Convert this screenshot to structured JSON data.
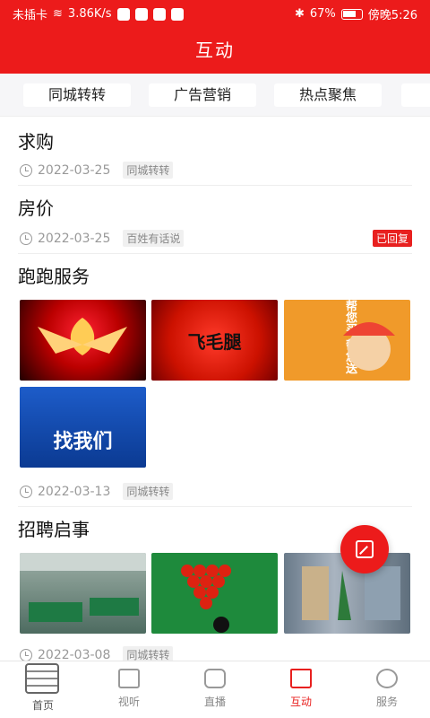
{
  "status_bar": {
    "carrier": "未插卡",
    "speed": "3.86K/s",
    "battery": "67%",
    "time": "傍晚5:26"
  },
  "header": {
    "title": "互动"
  },
  "tabs": [
    {
      "label": "同城转转"
    },
    {
      "label": "广告营销"
    },
    {
      "label": "热点聚焦"
    }
  ],
  "posts": [
    {
      "title": "求购",
      "date": "2022-03-25",
      "tag": "同城转转"
    },
    {
      "title": "房价",
      "date": "2022-03-25",
      "tag": "百姓有话说",
      "badge": "已回复"
    },
    {
      "title": "跑跑服务",
      "date": "2022-03-13",
      "tag": "同城转转",
      "images": [
        {
          "name": "flame-logo-image",
          "text": ""
        },
        {
          "name": "fei-mao-tui-image",
          "text": "飞毛腿"
        },
        {
          "name": "uu-errand-image",
          "text": "帮您买 帮您送"
        },
        {
          "name": "paotui-service-image",
          "text": "找我们"
        }
      ]
    },
    {
      "title": "招聘启事",
      "date": "2022-03-08",
      "tag": "同城转转",
      "images": [
        {
          "name": "billiard-hall-image",
          "text": ""
        },
        {
          "name": "snooker-balls-image",
          "text": ""
        },
        {
          "name": "shop-interior-image",
          "text": ""
        }
      ]
    }
  ],
  "bottom_nav": [
    {
      "label": "首页",
      "icon": "newspaper-icon",
      "active": false
    },
    {
      "label": "视听",
      "icon": "film-icon",
      "active": false
    },
    {
      "label": "直播",
      "icon": "camera-icon",
      "active": false
    },
    {
      "label": "互动",
      "icon": "house-icon",
      "active": true
    },
    {
      "label": "服务",
      "icon": "people-icon",
      "active": false
    }
  ],
  "colors": {
    "brand_red": "#ec1b1b",
    "badge_red": "#e8201f",
    "muted_gray": "#999999"
  }
}
